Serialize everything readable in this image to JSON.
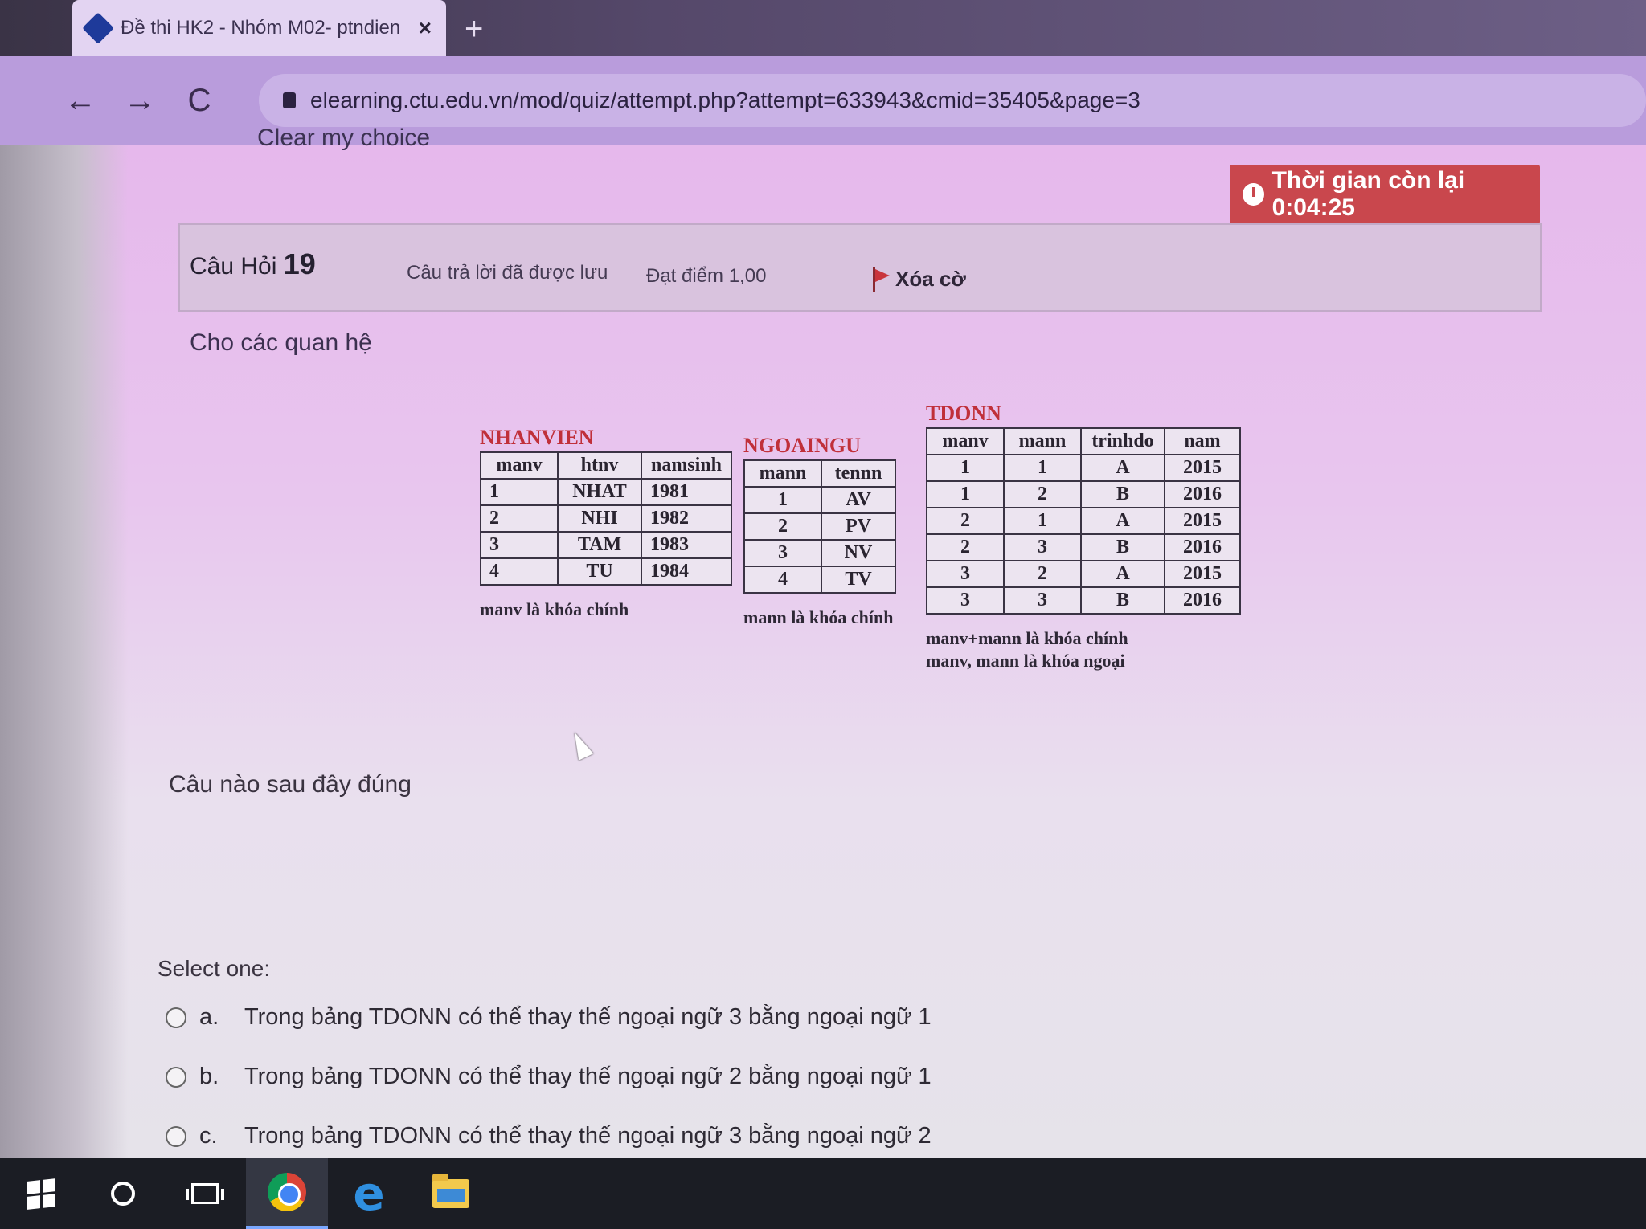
{
  "browser": {
    "tab_title": "Đề thi HK2 - Nhóm M02- ptndien",
    "tab_close": "×",
    "new_tab": "+",
    "back": "←",
    "forward": "→",
    "reload": "C",
    "url": "elearning.ctu.edu.vn/mod/quiz/attempt.php?attempt=633943&cmid=35405&page=3"
  },
  "quiz": {
    "clear_choice": "Clear my choice",
    "timer_text": "Thời gian còn lại 0:04:25",
    "question_label": "Câu Hỏi",
    "question_number": "19",
    "saved_status": "Câu trả lời đã được lưu",
    "score": "Đạt điểm 1,00",
    "flag_label": "Xóa cờ",
    "intro": "Cho các quan hệ",
    "question": "Câu nào sau đây đúng",
    "select_one": "Select one:",
    "options": [
      {
        "letter": "a.",
        "text": "Trong bảng TDONN có thể thay thế ngoại ngữ 3 bằng ngoại ngữ 1"
      },
      {
        "letter": "b.",
        "text": "Trong bảng TDONN có thể thay thế ngoại ngữ 2 bằng ngoại ngữ 1"
      },
      {
        "letter": "c.",
        "text": "Trong bảng TDONN có thể thay thế ngoại ngữ 3 bằng ngoại ngữ 2"
      }
    ]
  },
  "relations": {
    "nhanvien": {
      "name": "NHANVIEN",
      "headers": [
        "manv",
        "htnv",
        "namsinh"
      ],
      "rows": [
        [
          "1",
          "NHAT",
          "1981"
        ],
        [
          "2",
          "NHI",
          "1982"
        ],
        [
          "3",
          "TAM",
          "1983"
        ],
        [
          "4",
          "TU",
          "1984"
        ]
      ],
      "note": "manv là khóa chính"
    },
    "ngoaingu": {
      "name": "NGOAINGU",
      "headers": [
        "mann",
        "tennn"
      ],
      "rows": [
        [
          "1",
          "AV"
        ],
        [
          "2",
          "PV"
        ],
        [
          "3",
          "NV"
        ],
        [
          "4",
          "TV"
        ]
      ],
      "note": "mann là khóa chính"
    },
    "tdonn": {
      "name": "TDONN",
      "headers": [
        "manv",
        "mann",
        "trinhdo",
        "nam"
      ],
      "rows": [
        [
          "1",
          "1",
          "A",
          "2015"
        ],
        [
          "1",
          "2",
          "B",
          "2016"
        ],
        [
          "2",
          "1",
          "A",
          "2015"
        ],
        [
          "2",
          "3",
          "B",
          "2016"
        ],
        [
          "3",
          "2",
          "A",
          "2015"
        ],
        [
          "3",
          "3",
          "B",
          "2016"
        ]
      ],
      "note1": "manv+mann là khóa chính",
      "note2": "manv, mann là khóa ngoại"
    }
  },
  "taskbar": {
    "icons": [
      "windows-icon",
      "search-icon",
      "task-view-icon",
      "chrome-icon",
      "edge-icon",
      "file-explorer-icon"
    ],
    "edge_glyph": "e"
  },
  "colors": {
    "timer_bg": "#c9474d",
    "relation_name": "#c0303a"
  }
}
